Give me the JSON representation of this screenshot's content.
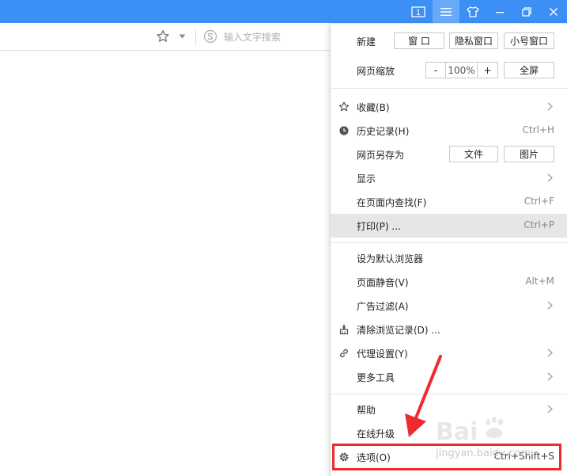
{
  "titlebar": {
    "tab_count": "1",
    "colors": {
      "bar": "#3b8ff5",
      "active_button": "#68aaf8"
    },
    "icons": [
      "tab-count-icon",
      "menu-icon",
      "skin-icon",
      "minimize-icon",
      "restore-icon",
      "close-icon"
    ]
  },
  "addressbar": {
    "search_placeholder": "输入文字搜索",
    "icons": [
      "star-icon",
      "dropdown-caret-icon",
      "sogou-search-icon"
    ]
  },
  "menu": {
    "new_label": "新建",
    "new_window": "窗 口",
    "new_private": "隐私窗口",
    "new_small": "小号窗口",
    "zoom_label": "网页缩放",
    "zoom_minus": "-",
    "zoom_value": "100%",
    "zoom_plus": "+",
    "fullscreen": "全屏",
    "items": [
      {
        "label": "收藏(B)",
        "shortcut": "",
        "icon": "star-icon",
        "submenu": true
      },
      {
        "label": "历史记录(H)",
        "shortcut": "Ctrl+H",
        "icon": "clock-icon",
        "submenu": false
      },
      {
        "label": "网页另存为",
        "shortcut": "",
        "icon": "",
        "submenu": false,
        "file_btn": "文件",
        "image_btn": "图片"
      },
      {
        "label": "显示",
        "shortcut": "",
        "icon": "",
        "submenu": true
      },
      {
        "label": "在页面内查找(F)",
        "shortcut": "Ctrl+F",
        "icon": "",
        "submenu": false
      },
      {
        "label": "打印(P) ...",
        "shortcut": "Ctrl+P",
        "icon": "",
        "submenu": false,
        "hover": true
      },
      {
        "label": "设为默认浏览器",
        "shortcut": "",
        "icon": "",
        "submenu": false
      },
      {
        "label": "页面静音(V)",
        "shortcut": "Alt+M",
        "icon": "",
        "submenu": false
      },
      {
        "label": "广告过滤(A)",
        "shortcut": "",
        "icon": "",
        "submenu": true
      },
      {
        "label": "清除浏览记录(D) ...",
        "shortcut": "",
        "icon": "broom-icon",
        "submenu": false
      },
      {
        "label": "代理设置(Y)",
        "shortcut": "",
        "icon": "link-icon",
        "submenu": true
      },
      {
        "label": "更多工具",
        "shortcut": "",
        "icon": "",
        "submenu": true
      },
      {
        "label": "帮助",
        "shortcut": "",
        "icon": "",
        "submenu": true
      },
      {
        "label": "在线升级",
        "shortcut": "",
        "icon": "",
        "submenu": false
      },
      {
        "label": "选项(O)",
        "shortcut": "Ctrl+Shift+S",
        "icon": "gear-icon",
        "submenu": false,
        "highlighted": true
      }
    ]
  },
  "annotation": {
    "highlight_color": "#ef2b30"
  },
  "watermark": {
    "text": "jingyan.baidu.com"
  }
}
